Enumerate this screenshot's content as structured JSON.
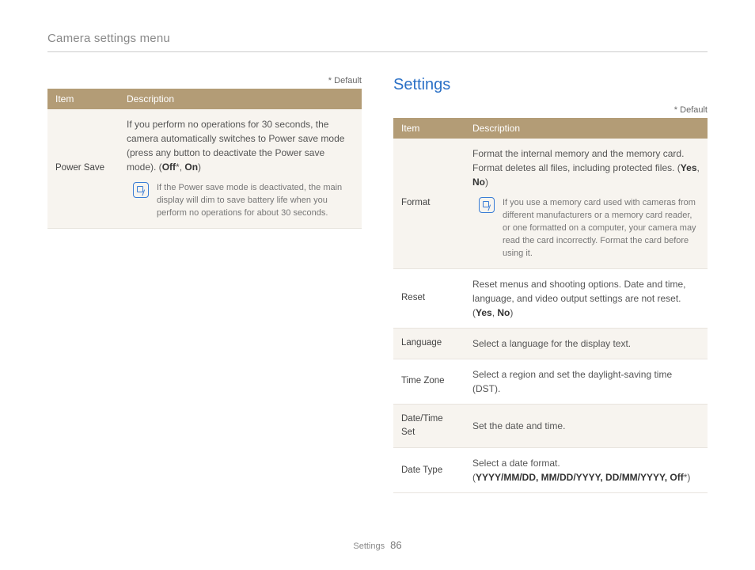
{
  "page_title": "Camera settings menu",
  "default_note": "* Default",
  "columns_header": {
    "item": "Item",
    "description": "Description"
  },
  "left_table": {
    "rows": [
      {
        "item": "Power Save",
        "desc_main": "If you perform no operations for 30 seconds, the camera automatically switches to Power save mode (press any button to deactivate the Power save mode). (",
        "opt1": "Off",
        "star1": "*",
        "sep": ", ",
        "opt2": "On",
        "close": ")",
        "note": "If the Power save mode is deactivated, the main display will dim to save battery life when you perform no operations for about 30 seconds."
      }
    ]
  },
  "right_heading": "Settings",
  "right_table": {
    "rows": [
      {
        "item": "Format",
        "desc_main": "Format the internal memory and the memory card. Format deletes all files, including protected files. (",
        "opt1": "Yes",
        "sep": ", ",
        "opt2": "No",
        "close": ")",
        "note": "If you use a memory card used with cameras from different manufacturers or a memory card reader, or one formatted on a computer, your camera may read the card incorrectly. Format the card before using it."
      },
      {
        "item": "Reset",
        "desc_main": "Reset menus and shooting options. Date and time, language, and video output settings are not reset. (",
        "opt1": "Yes",
        "sep": ", ",
        "opt2": "No",
        "close": ")"
      },
      {
        "item": "Language",
        "desc_main": "Select a language for the display text."
      },
      {
        "item": "Time Zone",
        "desc_main": "Select a region and set the daylight-saving time (DST)."
      },
      {
        "item": "Date/Time Set",
        "desc_main": "Set the date and time."
      },
      {
        "item": "Date Type",
        "desc_main": "Select a date format.",
        "line2_open": "(",
        "line2_bold": "YYYY/MM/DD, MM/DD/YYYY, DD/MM/YYYY, Off",
        "line2_star": "*",
        "line2_close": ")"
      }
    ]
  },
  "footer": {
    "section": "Settings",
    "page_number": "86"
  }
}
